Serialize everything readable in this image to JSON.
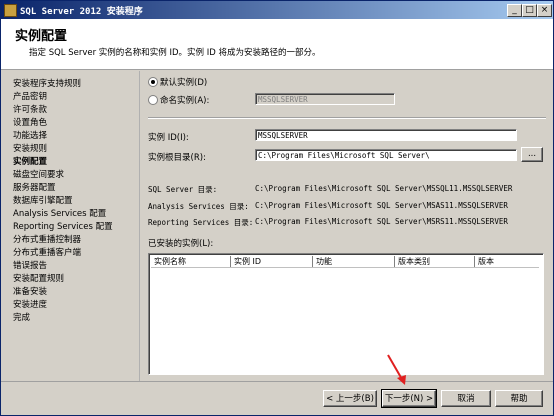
{
  "window": {
    "title": "SQL Server 2012 安装程序"
  },
  "header": {
    "title": "实例配置",
    "subtitle": "指定 SQL Server 实例的名称和实例 ID。实例 ID 将成为安装路径的一部分。"
  },
  "sidebar": {
    "items": [
      {
        "label": "安装程序支持规则"
      },
      {
        "label": "产品密钥"
      },
      {
        "label": "许可条款"
      },
      {
        "label": "设置角色"
      },
      {
        "label": "功能选择"
      },
      {
        "label": "安装规则"
      },
      {
        "label": "实例配置",
        "active": true
      },
      {
        "label": "磁盘空间要求"
      },
      {
        "label": "服务器配置"
      },
      {
        "label": "数据库引擎配置"
      },
      {
        "label": "Analysis Services 配置"
      },
      {
        "label": "Reporting Services 配置"
      },
      {
        "label": "分布式重播控制器"
      },
      {
        "label": "分布式重播客户端"
      },
      {
        "label": "错误报告"
      },
      {
        "label": "安装配置规则"
      },
      {
        "label": "准备安装"
      },
      {
        "label": "安装进度"
      },
      {
        "label": "完成"
      }
    ]
  },
  "instance": {
    "default_label": "默认实例(D)",
    "named_label": "命名实例(A):",
    "named_value": "MSSQLSERVER",
    "selected": "default",
    "id_label": "实例 ID(I):",
    "id_value": "MSSQLSERVER",
    "root_label": "实例根目录(R):",
    "root_value": "C:\\Program Files\\Microsoft SQL Server\\",
    "browse_label": "..."
  },
  "dirs": {
    "sql_label": "SQL Server 目录:",
    "sql_value": "C:\\Program Files\\Microsoft SQL Server\\MSSQL11.MSSQLSERVER",
    "as_label": "Analysis Services 目录:",
    "as_value": "C:\\Program Files\\Microsoft SQL Server\\MSAS11.MSSQLSERVER",
    "rs_label": "Reporting Services 目录:",
    "rs_value": "C:\\Program Files\\Microsoft SQL Server\\MSRS11.MSSQLSERVER"
  },
  "installed": {
    "label": "已安装的实例(L):",
    "columns": [
      "实例名称",
      "实例 ID",
      "功能",
      "版本类别",
      "版本"
    ]
  },
  "footer": {
    "back": "< 上一步(B)",
    "next": "下一步(N) >",
    "cancel": "取消",
    "help": "帮助"
  },
  "colors": {
    "titlebar_start": "#0a246a",
    "titlebar_end": "#a6caf0",
    "annotation_arrow": "#e02020"
  }
}
